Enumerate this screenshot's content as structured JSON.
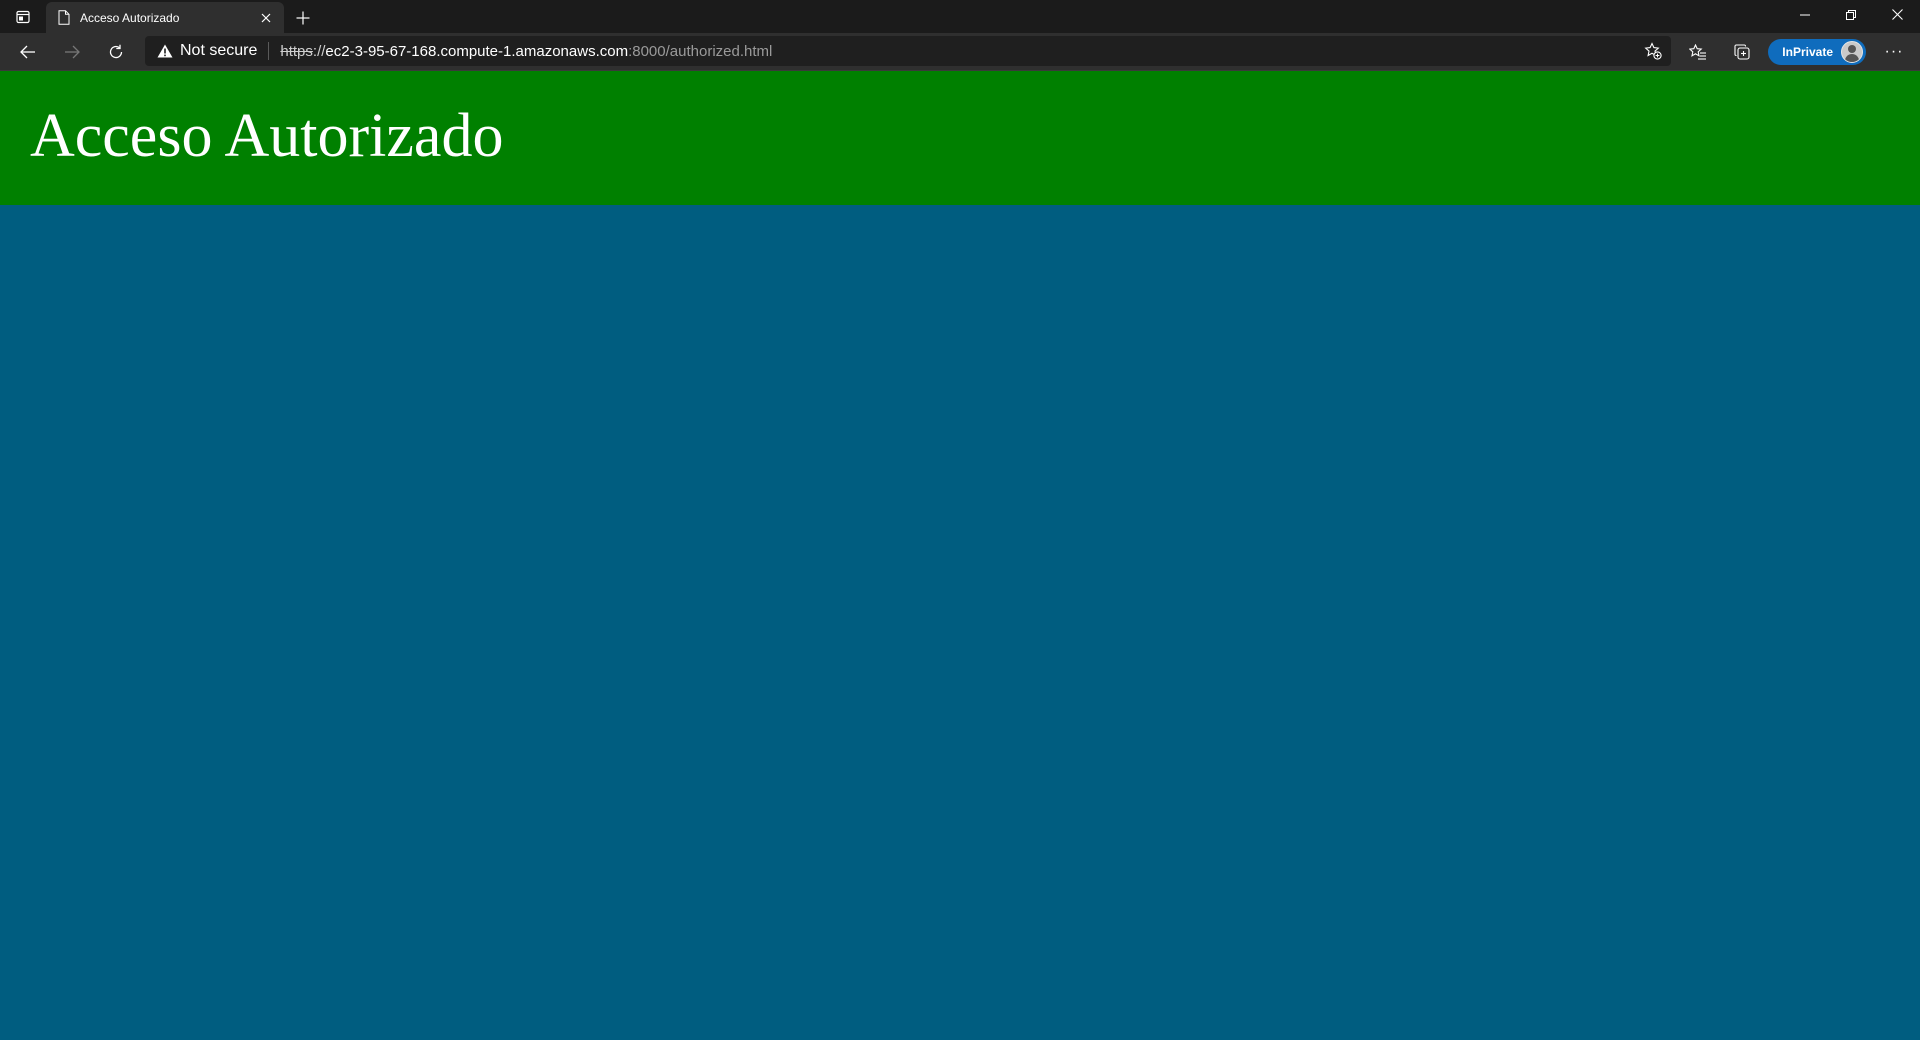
{
  "browser": {
    "tabs": [
      {
        "title": "Acceso Autorizado",
        "icon": "page-icon"
      }
    ],
    "address_bar": {
      "security_label": "Not secure",
      "url_scheme": "https",
      "url_separator": "://",
      "url_host": "ec2-3-95-67-168.compute-1.amazonaws.com",
      "url_rest": ":8000/authorized.html"
    },
    "profile_badge": "InPrivate",
    "more_label": "···"
  },
  "page": {
    "heading": "Acceso Autorizado"
  },
  "colors": {
    "header_bg": "#008000",
    "page_bg": "#005d80",
    "inprivate_badge": "#0f6cbd"
  }
}
